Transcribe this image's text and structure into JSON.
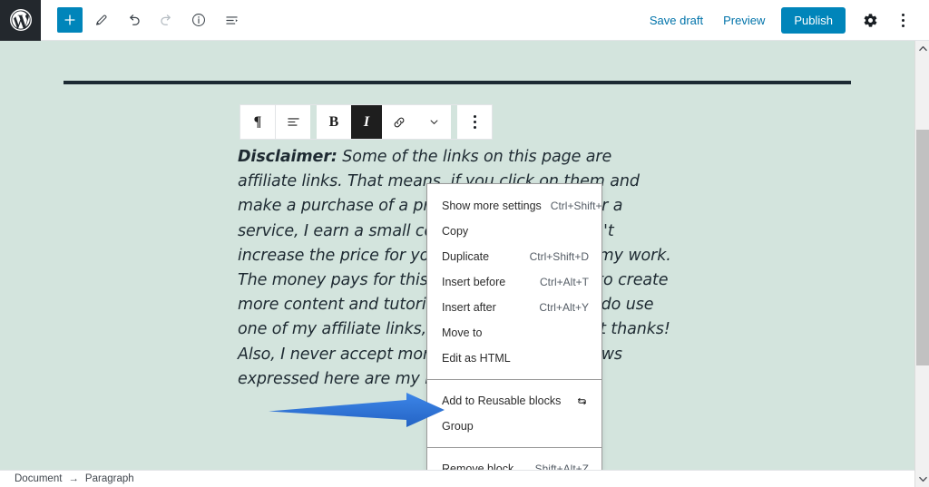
{
  "topbar": {
    "logo_icon": "wordpress-logo-icon",
    "add_block": {
      "icon": "plus-icon",
      "label": "+"
    },
    "tools": [
      {
        "name": "edit-pencil-icon",
        "glyph": "pencil"
      },
      {
        "name": "undo-icon",
        "glyph": "undo"
      },
      {
        "name": "redo-icon",
        "glyph": "redo"
      },
      {
        "name": "info-icon",
        "glyph": "info"
      },
      {
        "name": "block-navigation-icon",
        "glyph": "list"
      }
    ],
    "save_draft_label": "Save draft",
    "preview_label": "Preview",
    "publish_label": "Publish",
    "settings_icon": "gear-icon",
    "more_icon": "kebab-menu-icon",
    "accent_color": "#0085ba",
    "link_color": "#0073aa"
  },
  "block_toolbar": {
    "paragraph_icon": "paragraph-pilcrow-icon",
    "paragraph_glyph": "¶",
    "align_icon": "align-left-icon",
    "bold_label": "B",
    "italic_label": "I",
    "italic_active": true,
    "link_icon": "link-icon",
    "more_formats_icon": "chevron-down-icon",
    "block_options_icon": "kebab-menu-icon"
  },
  "content": {
    "disclaimer_label": "Disclaimer:",
    "paragraph_text": " Some of the links on this page are affiliate links. That means, if you click on them and make a purchase of a product or signing up for a service, I earn a small commission. This doesn't increase the price for you but it does support my work. The money pays for this site and enables me to create more content and tutorials on the blog. If you do use one of my affiliate links, you have my heartfelt thanks! Also, I never accept money for reviews. All views expressed here are my honest opinion."
  },
  "menu": {
    "sections": [
      {
        "items": [
          {
            "label": "Show more settings",
            "shortcut": "Ctrl+Shift+,",
            "icon": ""
          },
          {
            "label": "Copy",
            "shortcut": "",
            "icon": ""
          },
          {
            "label": "Duplicate",
            "shortcut": "Ctrl+Shift+D",
            "icon": ""
          },
          {
            "label": "Insert before",
            "shortcut": "Ctrl+Alt+T",
            "icon": ""
          },
          {
            "label": "Insert after",
            "shortcut": "Ctrl+Alt+Y",
            "icon": ""
          },
          {
            "label": "Move to",
            "shortcut": "",
            "icon": ""
          },
          {
            "label": "Edit as HTML",
            "shortcut": "",
            "icon": ""
          }
        ]
      },
      {
        "items": [
          {
            "label": "Add to Reusable blocks",
            "shortcut": "",
            "icon": "reusable-blocks-icon"
          },
          {
            "label": "Group",
            "shortcut": "",
            "icon": ""
          }
        ]
      },
      {
        "items": [
          {
            "label": "Remove block",
            "shortcut": "Shift+Alt+Z",
            "icon": ""
          }
        ]
      }
    ]
  },
  "annotation": {
    "arrow_color": "#2f79dd",
    "points_to": "Add to Reusable blocks"
  },
  "statusbar": {
    "breadcrumb": [
      "Document",
      "Paragraph"
    ],
    "separator_glyph": "→"
  },
  "scrollbar": {
    "up_glyph": "▲",
    "down_glyph": "▼"
  },
  "colors": {
    "canvas_background": "#d3e4dd",
    "separator_rule": "#1c2a33",
    "publish_blue": "#0085ba",
    "arrow_blue": "#2f79dd"
  }
}
